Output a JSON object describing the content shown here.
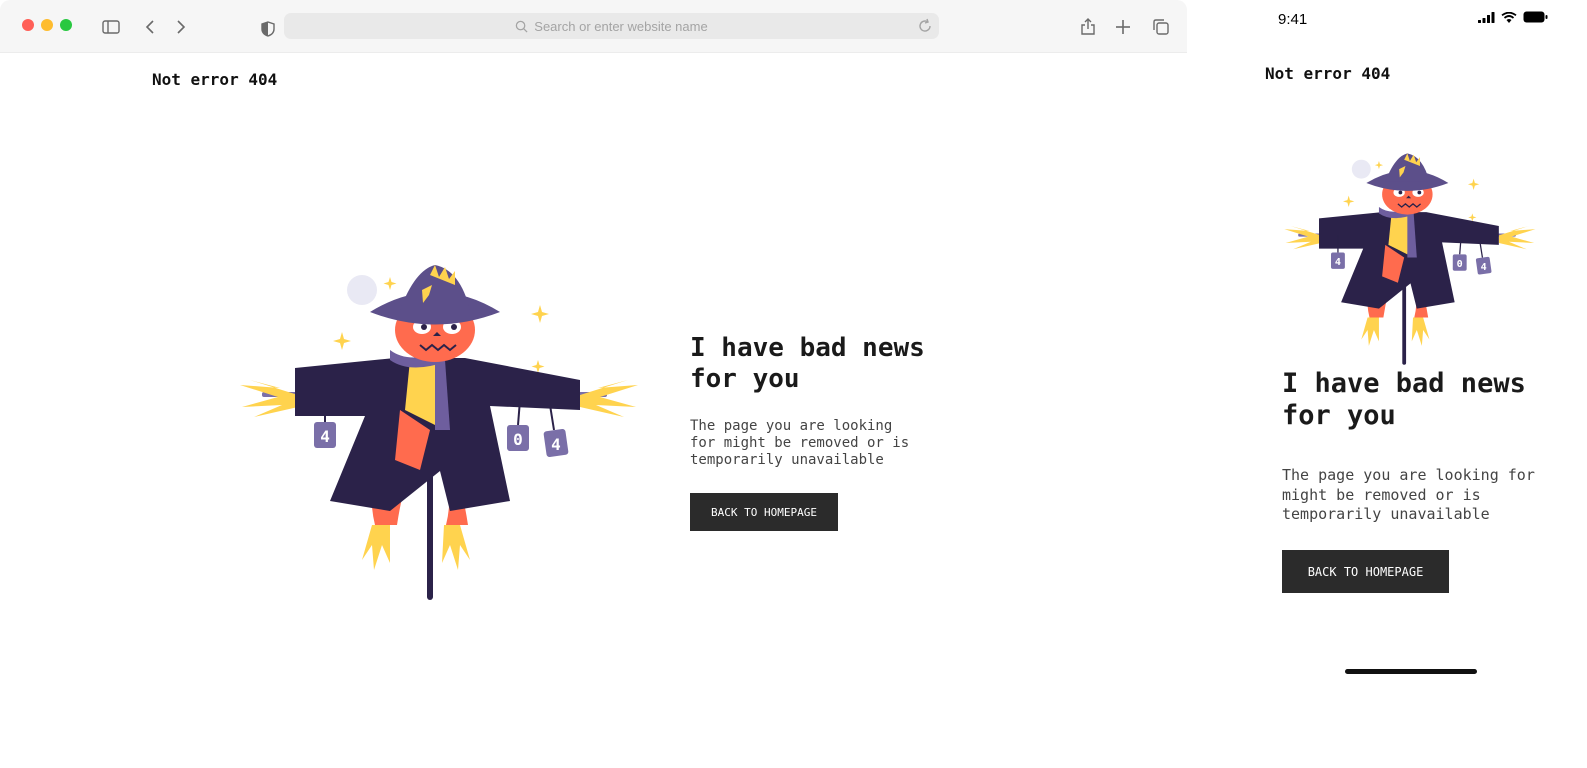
{
  "browser": {
    "search_placeholder": "Search or enter website name",
    "traffic_lights": [
      "#ff5f57",
      "#febc2e",
      "#28c840"
    ],
    "icons": [
      "sidebar-icon",
      "back-icon",
      "forward-icon",
      "shield-icon",
      "search-icon",
      "reload-icon",
      "share-icon",
      "new-tab-icon",
      "tabs-icon"
    ]
  },
  "page": {
    "site_title": "Not error 404",
    "headline_line1": "I have bad news",
    "headline_line2": "for you",
    "body_line1": "The page you are looking",
    "body_line2": "for might be removed or is",
    "body_line3": "temporarily unavailable",
    "button_label": "BACK TO HOMEPAGE",
    "illustration": {
      "can_labels": [
        "4",
        "0",
        "4"
      ],
      "colors": {
        "hat": "#5c4f8a",
        "coat": "#2b2249",
        "face": "#ff6b4e",
        "scarf": "#6e5e9e",
        "straw": "#ffd34e",
        "moon": "#e9e9f4"
      }
    }
  },
  "mobile": {
    "time": "9:41",
    "site_title": "Not error 404",
    "headline_line1": "I have bad news",
    "headline_line2": "for you",
    "body_line1": "The page you are looking for",
    "body_line2": "might be removed or is",
    "body_line3": "temporarily unavailable",
    "button_label": "BACK TO HOMEPAGE"
  }
}
